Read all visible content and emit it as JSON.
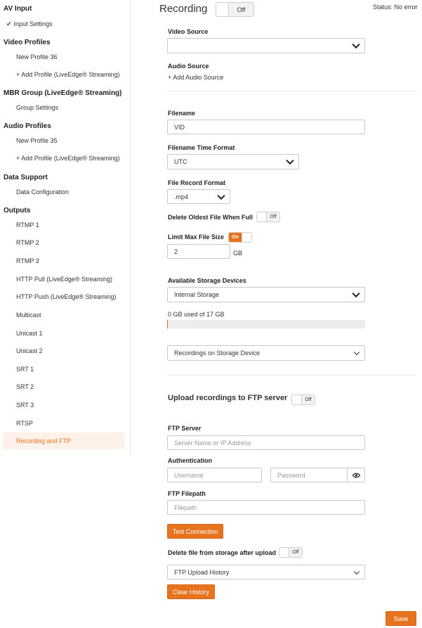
{
  "sidebar": {
    "sections": [
      {
        "heading": "AV Input",
        "items": [
          "Input Settings"
        ]
      },
      {
        "heading": "Video Profiles",
        "items": [
          "New Profile 36",
          "+ Add Profile (LiveEdge® Streaming)"
        ]
      },
      {
        "heading": "MBR Group (LiveEdge® Streaming)",
        "items": [
          "Group Settings"
        ]
      },
      {
        "heading": "Audio Profiles",
        "items": [
          "New Profile 35",
          "+ Add Profile (LiveEdge® Streaming)"
        ]
      },
      {
        "heading": "Data Support",
        "items": [
          "Data Configuration"
        ]
      },
      {
        "heading": "Outputs",
        "items": [
          "RTMP 1",
          "RTMP 2",
          "RTMP 3",
          "HTTP Pull (LiveEdge® Streaming)",
          "HTTP Push (LiveEdge® Streaming)",
          "Multicast",
          "Unicast 1",
          "Unicast 2",
          "SRT 1",
          "SRT 2",
          "SRT 3",
          "RTSP",
          "Recording and FTP"
        ]
      }
    ],
    "active_item": "Recording and FTP",
    "checked_item": "Input Settings"
  },
  "header": {
    "title": "Recording",
    "toggle": "Off",
    "status": "Status: No error"
  },
  "recording": {
    "video_source_label": "Video Source",
    "video_source_value": "",
    "audio_source_label": "Audio Source",
    "add_audio_source": "+ Add Audio Source",
    "filename_label": "Filename",
    "filename_value": "VID",
    "time_format_label": "Filename Time Format",
    "time_format_value": "UTC",
    "record_format_label": "File Record Format",
    "record_format_value": ".mp4",
    "delete_oldest_label": "Delete Oldest File When Full",
    "delete_oldest_toggle": "Off",
    "limit_size_label": "Limit Max File Size",
    "limit_size_toggle": "On",
    "limit_size_value": "2",
    "limit_size_unit": "GB",
    "storage_label": "Available Storage Devices",
    "storage_value": "Internal Storage",
    "storage_usage": "0 GB  used of 17 GB",
    "storage_used_fraction": 0.0,
    "recordings_select": "Recordings on Storage Device"
  },
  "ftp": {
    "heading": "Upload recordings to FTP server",
    "toggle": "Off",
    "server_label": "FTP Server",
    "server_placeholder": "Server Name or IP Address",
    "auth_label": "Authentication",
    "username_placeholder": "Username",
    "password_placeholder": "Password",
    "filepath_label": "FTP Filepath",
    "filepath_placeholder": "Filepath",
    "test_button": "Test Connection",
    "delete_label": "Delete file from storage after upload",
    "delete_toggle": "Off",
    "history_select": "FTP Upload History",
    "clear_button": "Clear History"
  },
  "footer": {
    "save_button": "Save"
  },
  "colors": {
    "accent": "#e8731f",
    "active_bg": "#fdf1ea",
    "check": "#3a8a3a"
  }
}
